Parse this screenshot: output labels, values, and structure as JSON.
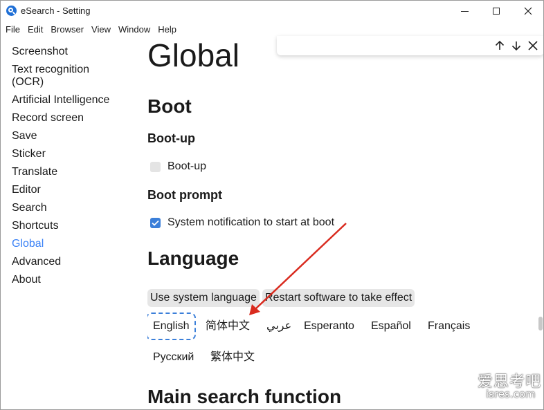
{
  "window": {
    "title": "eSearch - Setting",
    "app_icon": "esearch-logo-icon",
    "controls": [
      "minimize-icon",
      "maximize-icon",
      "close-icon"
    ]
  },
  "menubar": [
    "File",
    "Edit",
    "Browser",
    "View",
    "Window",
    "Help"
  ],
  "sidebar": {
    "active": "Global",
    "items": [
      {
        "label": "Screenshot"
      },
      {
        "label": "Text recognition (OCR)",
        "line1": "Text recognition",
        "line2": "(OCR)"
      },
      {
        "label": "Artificial Intelligence"
      },
      {
        "label": "Record screen"
      },
      {
        "label": "Save"
      },
      {
        "label": "Sticker"
      },
      {
        "label": "Translate"
      },
      {
        "label": "Editor"
      },
      {
        "label": "Search"
      },
      {
        "label": "Shortcuts"
      },
      {
        "label": "Global"
      },
      {
        "label": "Advanced"
      },
      {
        "label": "About"
      }
    ]
  },
  "main": {
    "page_title": "Global",
    "boot": {
      "heading": "Boot",
      "bootup_heading": "Boot-up",
      "bootup_label": "Boot-up",
      "bootup_checked": false,
      "prompt_heading": "Boot prompt",
      "prompt_label": "System notification to start at boot",
      "prompt_checked": true
    },
    "language": {
      "heading": "Language",
      "buttons": [
        "Use system language",
        "Restart software to take effect"
      ],
      "selected": "English",
      "options": [
        "English",
        "简体中文",
        "عربي",
        "Esperanto",
        "Español",
        "Français",
        "Русский",
        "繁体中文"
      ]
    },
    "next_heading": "Main search function"
  },
  "findbar": {
    "buttons": [
      "arrow-up-icon",
      "arrow-down-icon",
      "close-icon"
    ]
  },
  "watermark": {
    "line1": "爱思考吧",
    "line2": "isres.com"
  },
  "colors": {
    "accent": "#3b82f6",
    "checkbox_checked": "#3b7fd9",
    "annotation_arrow": "#d92b1f"
  }
}
